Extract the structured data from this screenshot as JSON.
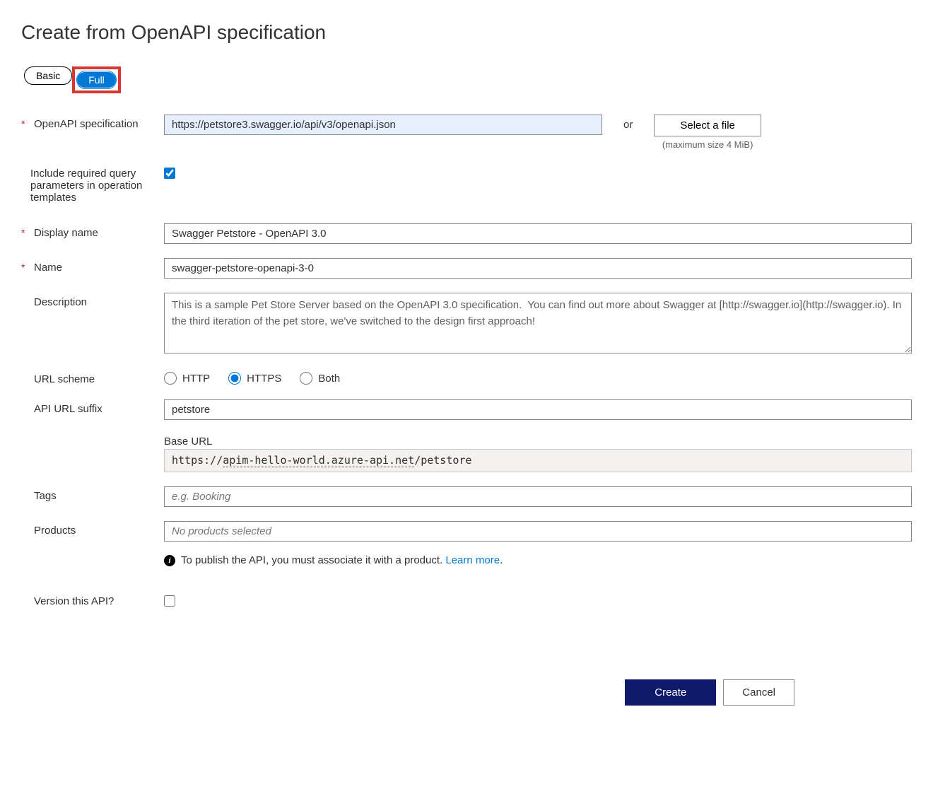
{
  "title": "Create from OpenAPI specification",
  "toggle": {
    "basic": "Basic",
    "full": "Full"
  },
  "openapi": {
    "label": "OpenAPI specification",
    "url": "https://petstore3.swagger.io/api/v3/openapi.json",
    "or": "or",
    "select_file": "Select a file",
    "size_hint": "(maximum size 4 MiB)"
  },
  "include_query": {
    "label": "Include required query parameters in operation templates",
    "checked": true
  },
  "display_name": {
    "label": "Display name",
    "value": "Swagger Petstore - OpenAPI 3.0"
  },
  "name": {
    "label": "Name",
    "value": "swagger-petstore-openapi-3-0"
  },
  "description": {
    "label": "Description",
    "value": "This is a sample Pet Store Server based on the OpenAPI 3.0 specification.  You can find out more about Swagger at [http://swagger.io](http://swagger.io). In the third iteration of the pet store, we've switched to the design first approach!"
  },
  "url_scheme": {
    "label": "URL scheme",
    "http": "HTTP",
    "https": "HTTPS",
    "both": "Both",
    "selected": "https"
  },
  "suffix": {
    "label": "API URL suffix",
    "value": "petstore"
  },
  "base_url": {
    "label": "Base URL",
    "proto": "https://",
    "domain": "apim-hello-world.azure-api.net",
    "path": "/petstore"
  },
  "tags": {
    "label": "Tags",
    "placeholder": "e.g. Booking"
  },
  "products": {
    "label": "Products",
    "placeholder": "No products selected",
    "hint": "To publish the API, you must associate it with a product. ",
    "learn_more": "Learn more"
  },
  "version": {
    "label": "Version this API?",
    "checked": false
  },
  "footer": {
    "create": "Create",
    "cancel": "Cancel"
  }
}
